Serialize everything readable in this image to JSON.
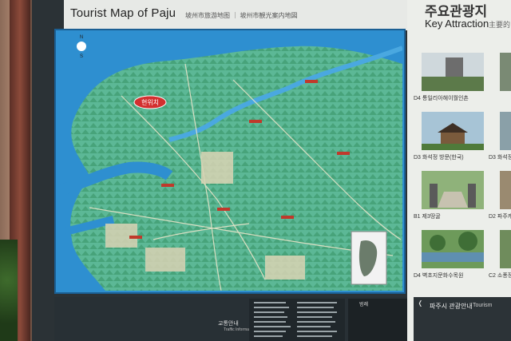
{
  "map_sign": {
    "title": "Tourist Map of Paju",
    "subtitle": "坡州市旅游地图 ｜ 坡州市観光案内地図",
    "red_label": "현위치"
  },
  "attractions": {
    "title_ko": "주요관광지",
    "title_en": "Key Attraction",
    "title_cn": "主要的",
    "items": [
      {
        "code": "D4",
        "label": "통일리아헤이월인촌"
      },
      {
        "code": "D3",
        "label": "화석정 방문(한국)"
      },
      {
        "code": "B1",
        "label": "제3땅굴"
      },
      {
        "code": "D4",
        "label": "벽초지문화수목원"
      }
    ],
    "side_captions": [
      "D3 화석정",
      "D2 파주캐",
      "C2 소풍정"
    ]
  },
  "lower_board": {
    "transport_ko": "교통안내",
    "transport_en": "Traffic Information",
    "legend_title": "범례",
    "info_title": "파주시 관광안내",
    "info_en": "Tourism"
  },
  "colors": {
    "water": "#2e8fd0",
    "land": "#5cb896",
    "mountain": "#3f9a6e",
    "board": "#2b3236"
  }
}
